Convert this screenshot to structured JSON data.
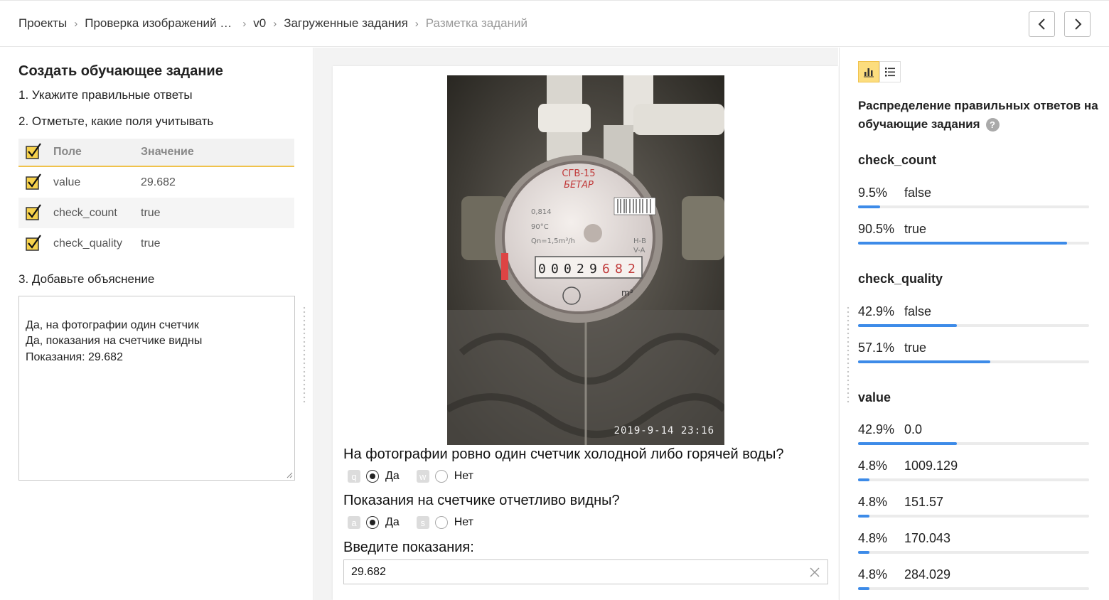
{
  "breadcrumbs": [
    {
      "label": "Проекты"
    },
    {
      "label": "Проверка изображений счетчиков"
    },
    {
      "label": "v0"
    },
    {
      "label": "Загруженные задания"
    },
    {
      "label": "Разметка заданий"
    }
  ],
  "left": {
    "title": "Создать обучающее задание",
    "step1": "1. Укажите правильные ответы",
    "step2": "2. Отметьте, какие поля учитывать",
    "table_header": {
      "field": "Поле",
      "value": "Значение"
    },
    "rows": [
      {
        "field": "value",
        "value": "29.682",
        "checked": true
      },
      {
        "field": "check_count",
        "value": "true",
        "checked": true
      },
      {
        "field": "check_quality",
        "value": "true",
        "checked": true
      }
    ],
    "step3": "3. Добавьте объяснение",
    "explanation": "Да, на фотографии один счетчик\nДа, показания на счетчике видны\nПоказания: 29.682"
  },
  "task": {
    "photo_timestamp": "2019-9-14 23:16",
    "q1": {
      "text": "На фотографии ровно один счетчик холодной либо горячей воды?",
      "yes_key": "q",
      "yes_label": "Да",
      "no_key": "w",
      "no_label": "Нет",
      "selected": "yes"
    },
    "q2": {
      "text": "Показания на счетчике отчетливо видны?",
      "yes_key": "a",
      "yes_label": "Да",
      "no_key": "s",
      "no_label": "Нет",
      "selected": "yes"
    },
    "q3": {
      "text": "Введите показания:",
      "value": "29.682"
    }
  },
  "stats": {
    "title": "Распределение правильных ответов на обучающие задания",
    "help_icon": "?",
    "accent_color": "#3d8be8",
    "check_count": {
      "label": "check_count",
      "items": [
        {
          "pct": "9.5%",
          "label": "false",
          "fraction": 0.095
        },
        {
          "pct": "90.5%",
          "label": "true",
          "fraction": 0.905
        }
      ]
    },
    "check_quality": {
      "label": "check_quality",
      "items": [
        {
          "pct": "42.9%",
          "label": "false",
          "fraction": 0.429
        },
        {
          "pct": "57.1%",
          "label": "true",
          "fraction": 0.571
        }
      ]
    },
    "value": {
      "label": "value",
      "items": [
        {
          "pct": "42.9%",
          "label": "0.0",
          "fraction": 0.429
        },
        {
          "pct": "4.8%",
          "label": "1009.129",
          "fraction": 0.048
        },
        {
          "pct": "4.8%",
          "label": "151.57",
          "fraction": 0.048
        },
        {
          "pct": "4.8%",
          "label": "170.043",
          "fraction": 0.048
        },
        {
          "pct": "4.8%",
          "label": "284.029",
          "fraction": 0.048
        }
      ]
    }
  }
}
